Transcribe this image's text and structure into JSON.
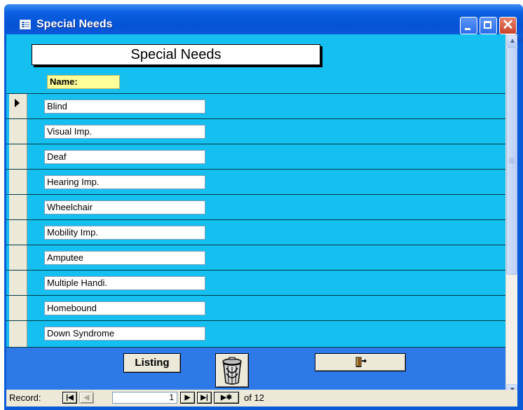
{
  "window": {
    "title": "Special Needs",
    "icon": "form-icon"
  },
  "form": {
    "header": "Special Needs",
    "name_label": "Name:",
    "records": [
      {
        "name": "Blind",
        "current": true
      },
      {
        "name": "Visual Imp.",
        "current": false
      },
      {
        "name": "Deaf",
        "current": false
      },
      {
        "name": "Hearing Imp.",
        "current": false
      },
      {
        "name": "Wheelchair",
        "current": false
      },
      {
        "name": "Mobility Imp.",
        "current": false
      },
      {
        "name": "Amputee",
        "current": false
      },
      {
        "name": "Multiple Handi.",
        "current": false
      },
      {
        "name": "Homebound",
        "current": false
      },
      {
        "name": "Down Syndrome",
        "current": false
      }
    ],
    "buttons": {
      "listing_label": "Listing",
      "delete_icon": "trash-can-icon",
      "exit_icon": "exit-door-icon"
    }
  },
  "navigator": {
    "label": "Record:",
    "current_record": "1",
    "of_text": "of 12"
  },
  "colors": {
    "form_background": "#15bfef",
    "footer_background": "#2e79e8",
    "label_background": "#ffff99",
    "title_bar": "#0553d6"
  }
}
